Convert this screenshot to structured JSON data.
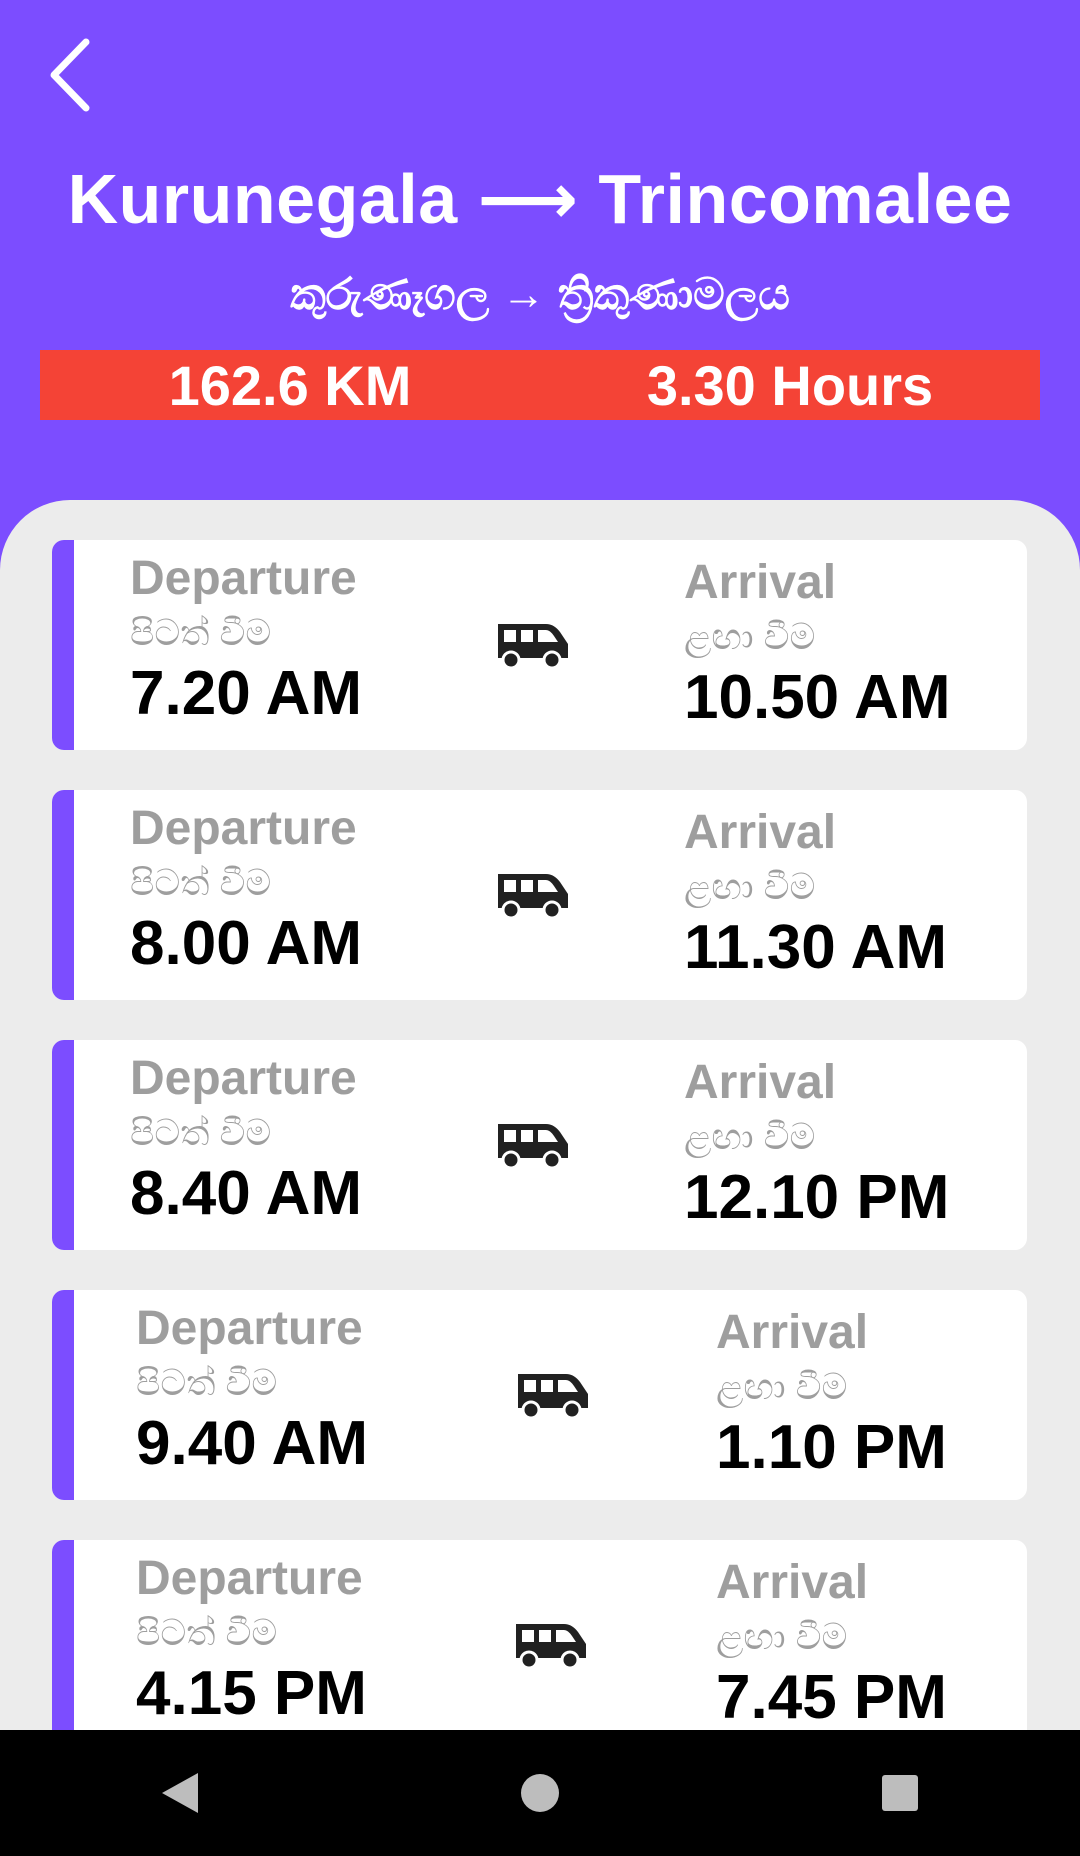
{
  "header": {
    "title": "Kurunegala ⟶ Trincomalee",
    "subtitle": "කුරුණෑගල → ත්‍රිකුණාමලය",
    "distance": "162.6 KM",
    "duration": "3.30 Hours"
  },
  "labels": {
    "departure_en": "Departure",
    "departure_si": "පිටත් වීම",
    "arrival_en": "Arrival",
    "arrival_si": "ළඟා වීම"
  },
  "schedules": [
    {
      "departure": "7.20 AM",
      "arrival": "10.50 AM"
    },
    {
      "departure": "8.00 AM",
      "arrival": "11.30 AM"
    },
    {
      "departure": "8.40 AM",
      "arrival": "12.10 PM"
    },
    {
      "departure": "9.40 AM",
      "arrival": "1.10 PM"
    },
    {
      "departure": "4.15 PM",
      "arrival": "7.45 PM"
    }
  ],
  "colors": {
    "primary": "#7c4dff",
    "stats_bar": "#f44336",
    "background_panel": "#ececec"
  },
  "icons": {
    "back": "chevron-left-icon",
    "bus": "bus-icon",
    "nav_back": "triangle-back-icon",
    "nav_home": "circle-home-icon",
    "nav_recents": "square-recents-icon"
  }
}
